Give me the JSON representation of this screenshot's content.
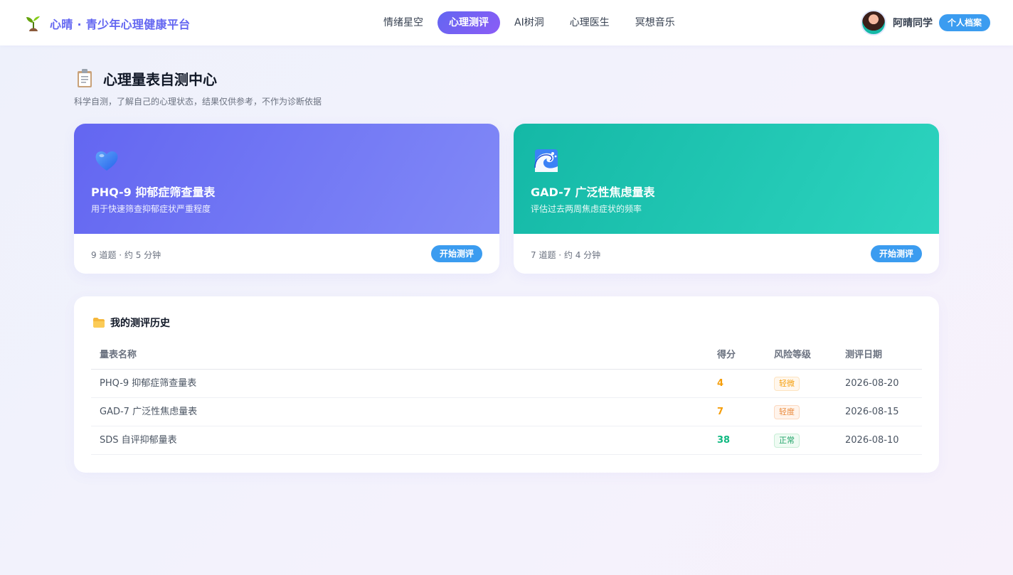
{
  "app": {
    "brand": "心晴 · 青少年心理健康平台"
  },
  "nav": {
    "items": [
      {
        "label": "情绪星空",
        "active": false
      },
      {
        "label": "心理测评",
        "active": true
      },
      {
        "label": "AI树洞",
        "active": false
      },
      {
        "label": "心理医生",
        "active": false
      },
      {
        "label": "冥想音乐",
        "active": false
      }
    ]
  },
  "user": {
    "name": "阿晴同学",
    "profile_label": "个人档案"
  },
  "header": {
    "title": "心理量表自测中心",
    "subtitle": "科学自测，了解自己的心理状态，结果仅供参考，不作为诊断依据"
  },
  "cards": [
    {
      "icon": "blue-heart-icon",
      "title": "PHQ-9 抑郁症筛查量表",
      "desc": "用于快速筛查抑郁症状严重程度",
      "meta": "9 道题 · 约 5 分钟",
      "button": "开始测评",
      "color": "#6366f1"
    },
    {
      "icon": "water-wave-icon",
      "title": "GAD-7 广泛性焦虑量表",
      "desc": "评估过去两周焦虑症状的频率",
      "meta": "7 道题 · 约 4 分钟",
      "button": "开始测评",
      "color": "#14b8a6"
    }
  ],
  "history": {
    "title": "我的测评历史",
    "columns": {
      "name": "量表名称",
      "score": "得分",
      "risk": "风险等级",
      "date": "测评日期"
    },
    "rows": [
      {
        "name": "PHQ-9 抑郁症筛查量表",
        "score": "4",
        "risk": "轻微",
        "date": "2026-08-20",
        "score_color": "#f59e0b",
        "badge_color": "#f59e0b",
        "badge_bg": "#fff7ed",
        "badge_border": "#fde3c0"
      },
      {
        "name": "GAD-7 广泛性焦虑量表",
        "score": "7",
        "risk": "轻度",
        "date": "2026-08-15",
        "score_color": "#f59e0b",
        "badge_color": "#ea8a3c",
        "badge_bg": "#fff4ec",
        "badge_border": "#fcd9c0"
      },
      {
        "name": "SDS 自评抑郁量表",
        "score": "38",
        "risk": "正常",
        "date": "2026-08-10",
        "score_color": "#10b981",
        "badge_color": "#22a36a",
        "badge_bg": "#effbf3",
        "badge_border": "#c7eed6"
      }
    ]
  }
}
